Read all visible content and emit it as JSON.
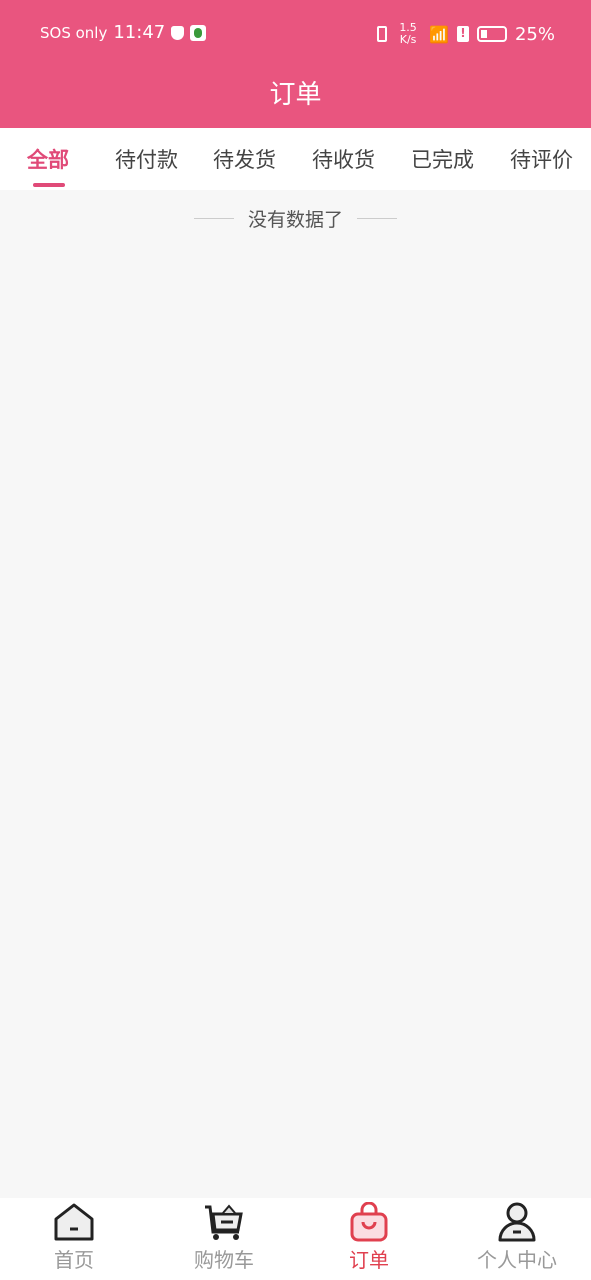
{
  "status_bar": {
    "carrier": "SOS only",
    "time": "11:47",
    "net_speed": "1.5 K/s",
    "battery": "25%"
  },
  "header": {
    "title": "订单"
  },
  "tabs": [
    {
      "label": "全部",
      "active": true
    },
    {
      "label": "待付款"
    },
    {
      "label": "待发货"
    },
    {
      "label": "待收货"
    },
    {
      "label": "已完成"
    },
    {
      "label": "待评价"
    }
  ],
  "empty_message": "没有数据了",
  "nav": [
    {
      "label": "首页",
      "icon": "home-icon"
    },
    {
      "label": "购物车",
      "icon": "cart-icon"
    },
    {
      "label": "订单",
      "icon": "bag-icon",
      "active": true
    },
    {
      "label": "个人中心",
      "icon": "user-icon"
    }
  ],
  "colors": {
    "brand": "#e9557f",
    "active_tab": "#e04a78",
    "active_nav": "#e0404f"
  }
}
